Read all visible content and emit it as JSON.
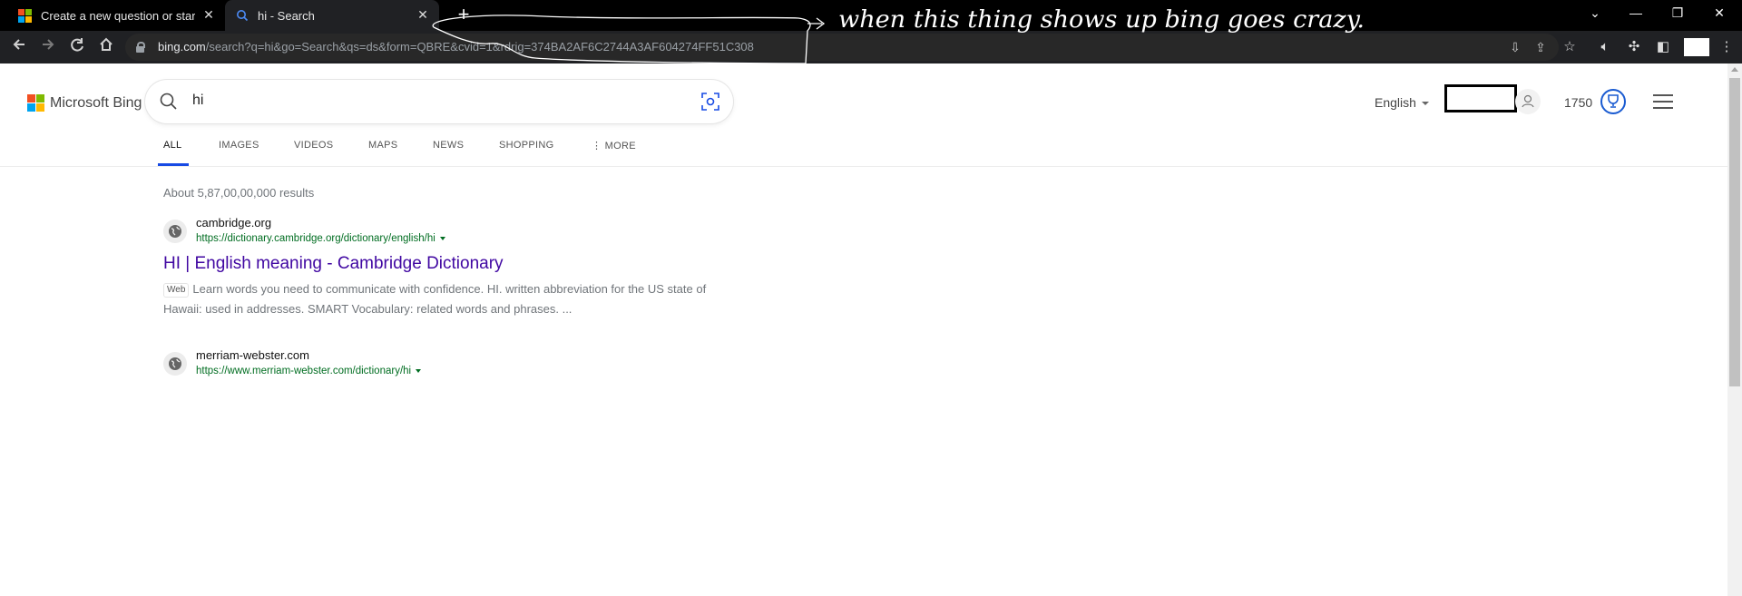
{
  "browser": {
    "tabs": [
      {
        "title": "Create a new question or start a discussion"
      },
      {
        "title": "hi - Search"
      }
    ],
    "new_tab_label": "+",
    "url_host": "bing.com",
    "url_path": "/search?q=hi&go=Search&qs=ds&form=QBRE&cvid=1&rdrig=374BA2AF6C2744A3AF604274FF51C308",
    "annotation_text": "when this thing shows up bing goes crazy."
  },
  "bing": {
    "brand": "Microsoft Bing",
    "query": "hi",
    "language": "English",
    "rewards_points": "1750",
    "scopes": [
      "ALL",
      "IMAGES",
      "VIDEOS",
      "MAPS",
      "NEWS",
      "SHOPPING",
      "MORE"
    ],
    "active_scope": "ALL",
    "result_count": "About 5,87,00,00,000 results",
    "results": [
      {
        "site": "cambridge.org",
        "url": "https://dictionary.cambridge.org/dictionary/english/hi",
        "title": "HI | English meaning - Cambridge Dictionary",
        "tag": "Web",
        "snippet": "Learn words you need to communicate with confidence. HI. written abbreviation for the US state of Hawaii: used in addresses. SMART Vocabulary: related words and phrases. ..."
      },
      {
        "site": "merriam-webster.com",
        "url": "https://www.merriam-webster.com/dictionary/hi"
      }
    ]
  },
  "colors": {
    "link_title": "#4007a2",
    "cite_green": "#006d21",
    "accent_blue": "#174ae4",
    "ms_red": "#f25022",
    "ms_green": "#7fba00",
    "ms_blue": "#00a4ef",
    "ms_yellow": "#ffb900"
  }
}
